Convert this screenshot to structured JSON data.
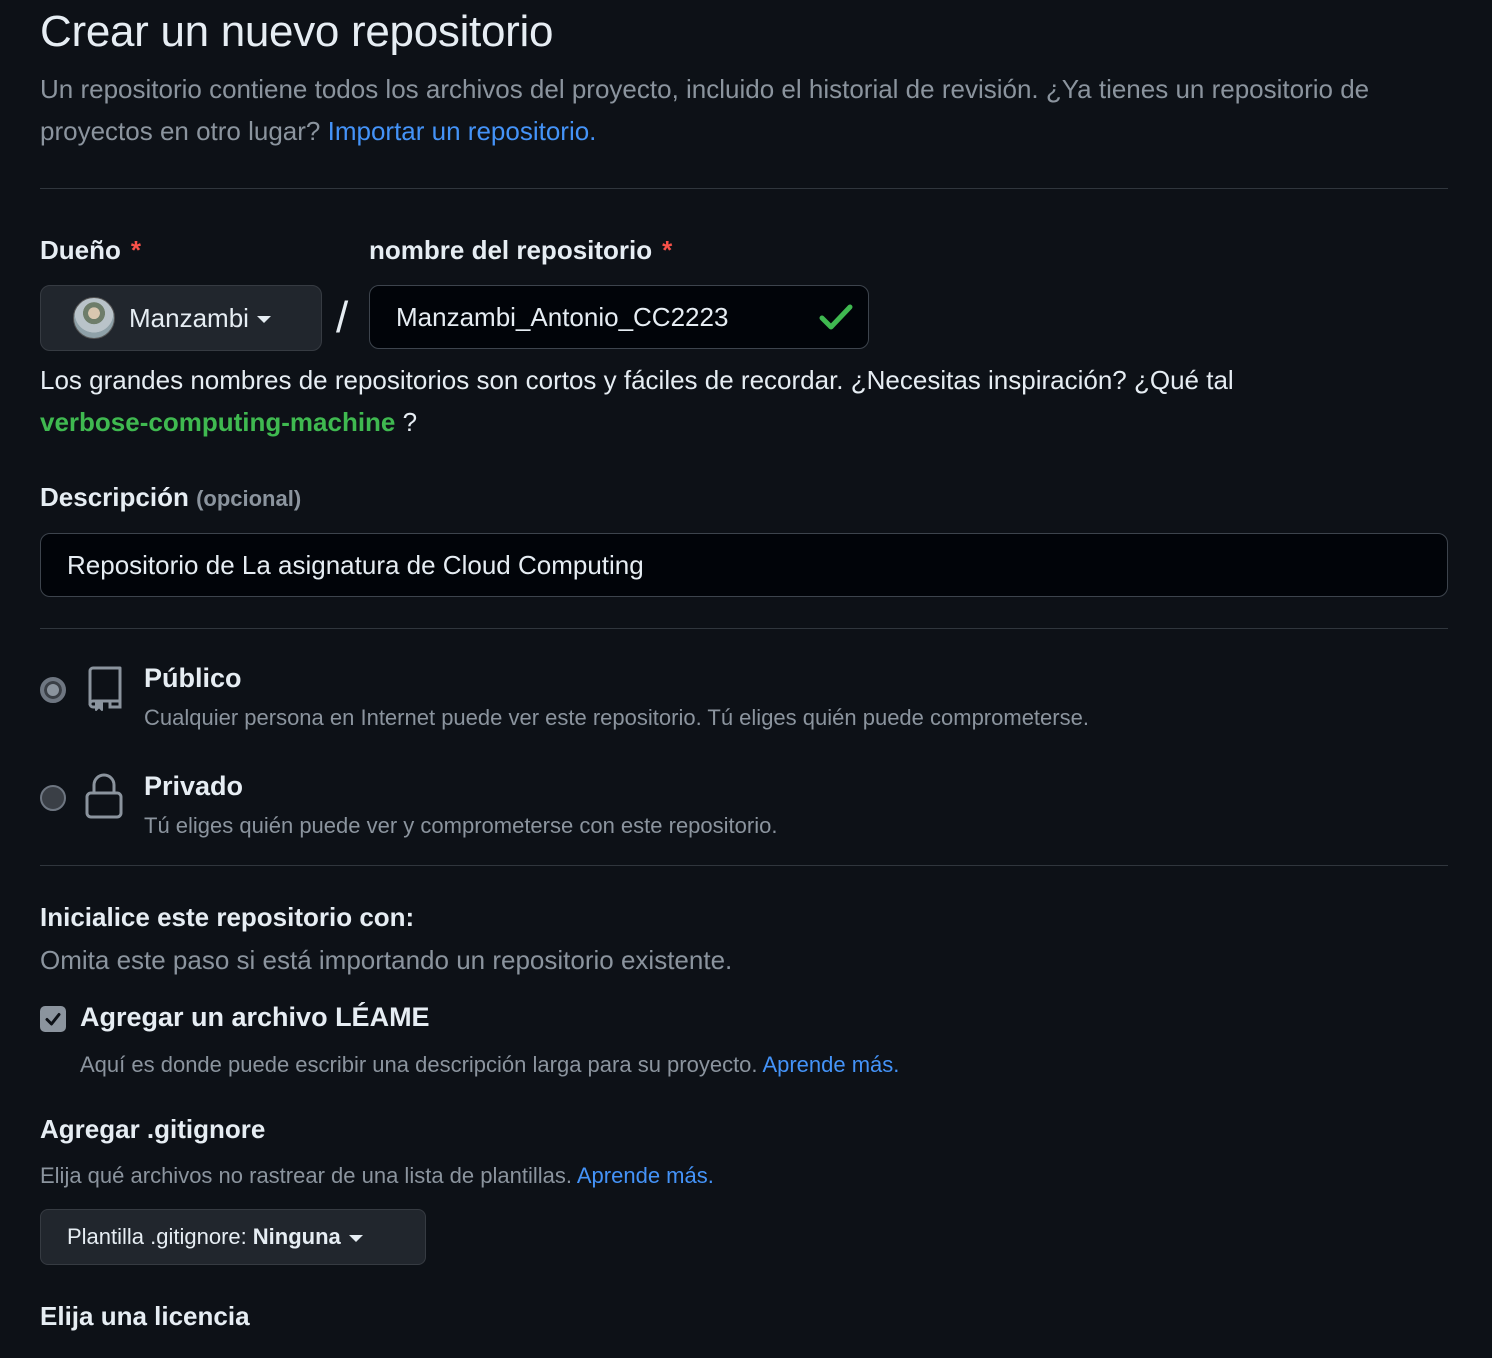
{
  "page": {
    "title": "Crear un nuevo repositorio",
    "intro_text": "Un repositorio contiene todos los archivos del proyecto, incluido el historial de revisión. ¿Ya tienes un repositorio de proyectos en otro lugar?",
    "import_link": "Importar un repositorio."
  },
  "owner": {
    "label": "Dueño",
    "required_marker": "*",
    "value": "Manzambi"
  },
  "repo_name": {
    "label": "nombre del repositorio",
    "required_marker": "*",
    "separator": "/",
    "value": "Manzambi_Antonio_CC2223",
    "valid": true
  },
  "name_hint": {
    "text": "Los grandes nombres de repositorios son cortos y fáciles de recordar. ¿Necesitas inspiración? ¿Qué tal",
    "suggestion": "verbose-computing-machine",
    "suffix": "?"
  },
  "description": {
    "label": "Descripción",
    "optional": "(opcional)",
    "value": "Repositorio de La asignatura de Cloud Computing"
  },
  "visibility": {
    "selected": "public",
    "options": [
      {
        "id": "public",
        "icon": "repo-icon",
        "title": "Público",
        "description": "Cualquier persona en Internet puede ver este repositorio. Tú eliges quién puede comprometerse."
      },
      {
        "id": "private",
        "icon": "lock-icon",
        "title": "Privado",
        "description": "Tú eliges quién puede ver y comprometerse con este repositorio."
      }
    ]
  },
  "initialize": {
    "heading": "Inicialice este repositorio con:",
    "subtext": "Omita este paso si está importando un repositorio existente.",
    "readme": {
      "checked": true,
      "label": "Agregar un archivo LÉAME",
      "description": "Aquí es donde puede escribir una descripción larga para su proyecto.",
      "learn_more": "Aprende más."
    }
  },
  "gitignore": {
    "title": "Agregar .gitignore",
    "description": "Elija qué archivos no rastrear de una lista de plantillas.",
    "learn_more": "Aprende más.",
    "button_prefix": "Plantilla .gitignore:",
    "button_value": "Ninguna"
  },
  "license": {
    "title": "Elija una licencia"
  },
  "colors": {
    "background": "#0d1117",
    "link": "#4493f8",
    "success": "#3fb950",
    "danger": "#f85149",
    "muted": "#8b949e"
  }
}
